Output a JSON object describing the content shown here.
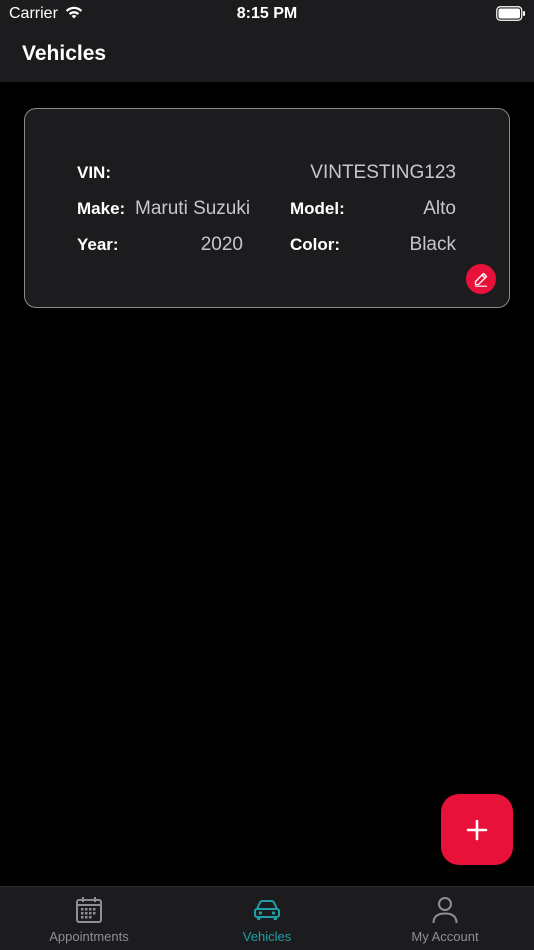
{
  "status_bar": {
    "carrier": "Carrier",
    "time": "8:15 PM"
  },
  "header": {
    "title": "Vehicles"
  },
  "vehicle": {
    "vin_label": "VIN:",
    "vin_value": "VINTESTING123",
    "make_label": "Make:",
    "make_value": "Maruti Suzuki",
    "model_label": "Model:",
    "model_value": "Alto",
    "year_label": "Year:",
    "year_value": "2020",
    "color_label": "Color:",
    "color_value": "Black"
  },
  "tabs": [
    {
      "label": "Appointments",
      "icon": "calendar-icon",
      "active": false
    },
    {
      "label": "Vehicles",
      "icon": "car-icon",
      "active": true
    },
    {
      "label": "My Account",
      "icon": "person-icon",
      "active": false
    }
  ],
  "colors": {
    "accent": "#e8113a",
    "active_tab": "#1e9ea6",
    "inactive_tab": "#8e8e93",
    "background": "#000000",
    "surface": "#1c1c1e"
  }
}
